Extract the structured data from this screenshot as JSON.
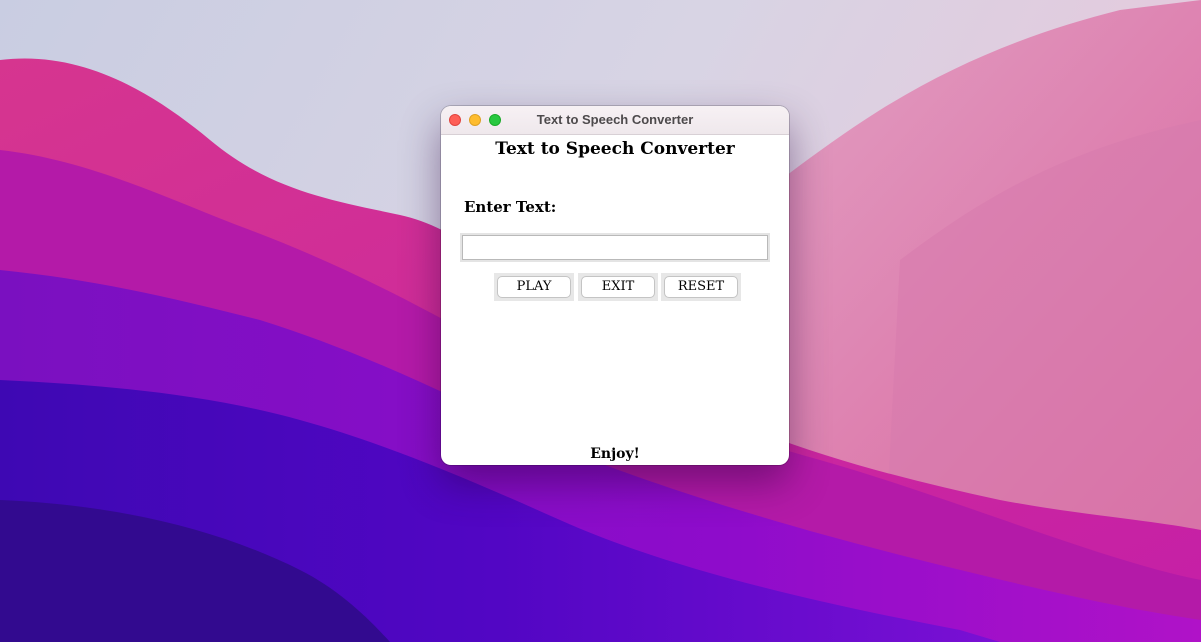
{
  "window": {
    "title": "Text to Speech Converter"
  },
  "app": {
    "heading": "Text to Speech Converter",
    "input_label": "Enter Text:",
    "input_value": "",
    "buttons": {
      "play": "PLAY",
      "exit": "EXIT",
      "reset": "RESET"
    },
    "footer": "Enjoy!"
  },
  "colors": {
    "close_button": "#fe5f57",
    "minimize_button": "#febc2e",
    "zoom_button": "#28c840",
    "window_background": "#ffffff"
  },
  "icons": [
    "close-icon",
    "minimize-icon",
    "zoom-icon"
  ]
}
